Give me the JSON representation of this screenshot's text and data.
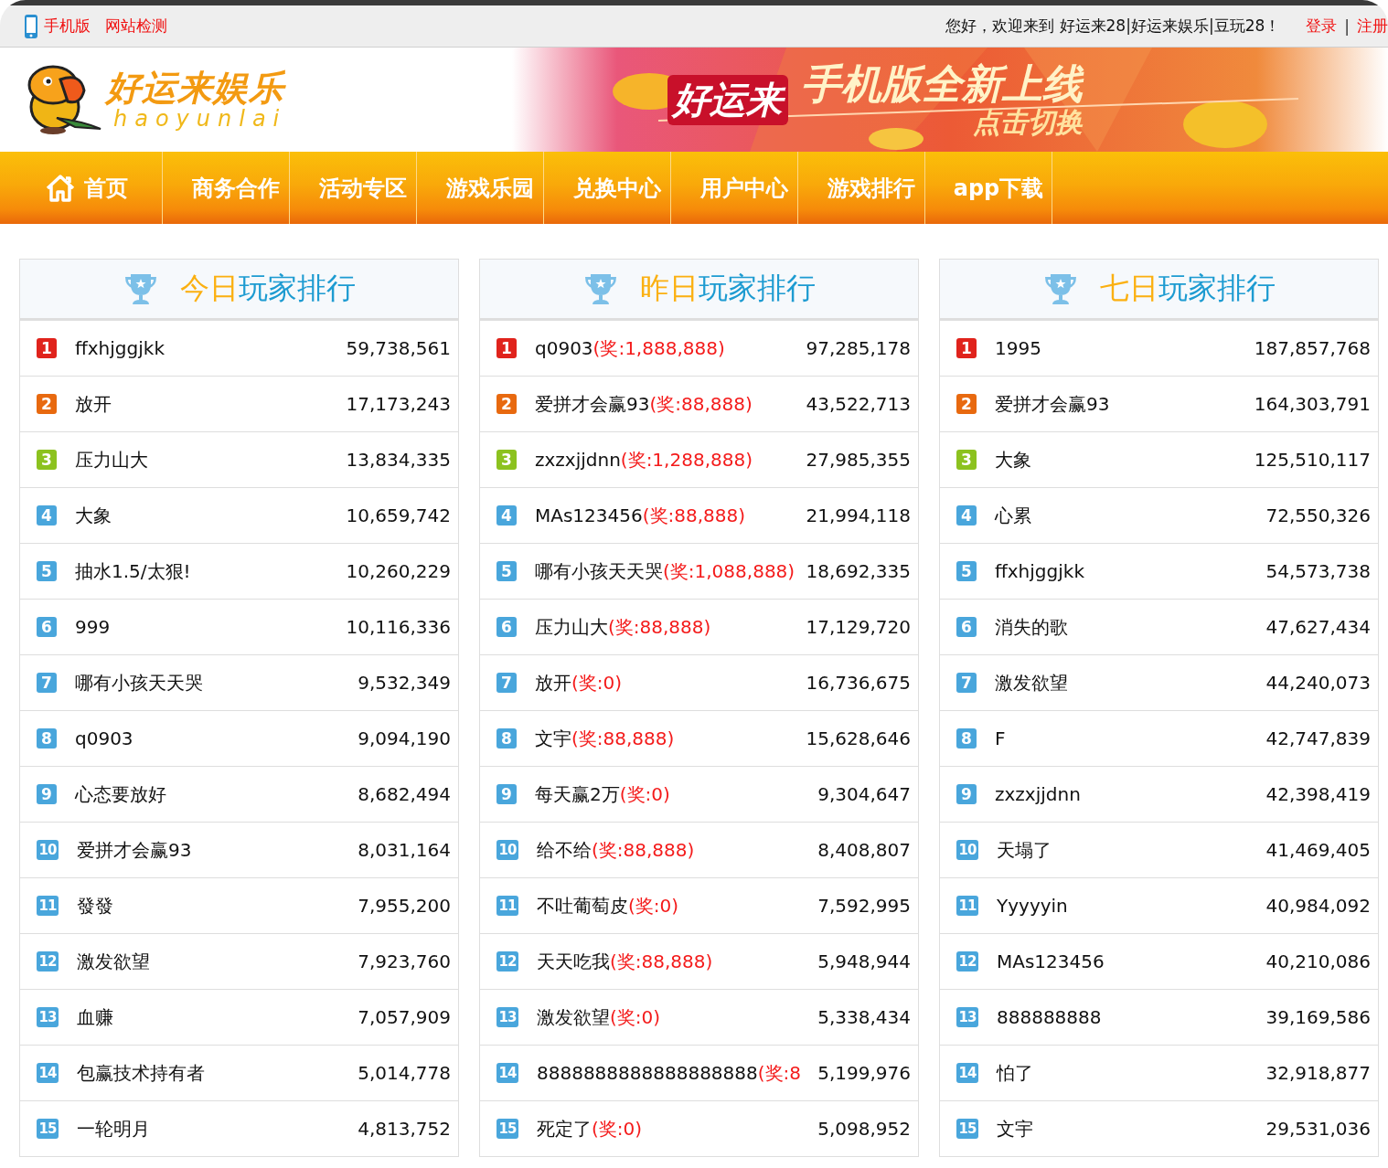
{
  "top_bar": {
    "left_links": [
      "手机版",
      "网站检测"
    ],
    "welcome": "您好，欢迎来到 好运来28|好运来娱乐|豆玩28！",
    "right_links": [
      "登录",
      "注册"
    ],
    "separator": "|"
  },
  "header": {
    "logo_title": "好运来娱乐",
    "logo_subtitle": "haoyunlai",
    "banner": {
      "brand": "好运来",
      "headline": "手机版全新上线",
      "subline": "点击切换"
    }
  },
  "nav": [
    {
      "label": "首页",
      "kind": "home"
    },
    {
      "label": "商务合作",
      "kind": "plain"
    },
    {
      "label": "活动专区",
      "kind": "plain"
    },
    {
      "label": "游戏乐园",
      "kind": "plain"
    },
    {
      "label": "兑换中心",
      "kind": "plain"
    },
    {
      "label": "用户中心",
      "kind": "plain"
    },
    {
      "label": "游戏排行",
      "kind": "plain"
    },
    {
      "label": "app下载",
      "kind": "plain"
    }
  ],
  "rankings": [
    {
      "title_highlight": "今日",
      "title_rest": "玩家排行",
      "rows": [
        {
          "rank": "1",
          "color": "#e0231c",
          "name": "ffxhjggjkk",
          "score": "59,738,561"
        },
        {
          "rank": "2",
          "color": "#e8690f",
          "name": "放开",
          "score": "17,173,243"
        },
        {
          "rank": "3",
          "color": "#8cc21f",
          "name": "压力山大",
          "score": "13,834,335"
        },
        {
          "rank": "4",
          "color": "#49a6dc",
          "name": "大象",
          "score": "10,659,742"
        },
        {
          "rank": "5",
          "color": "#49a6dc",
          "name": "抽水1.5/太狠!",
          "score": "10,260,229"
        },
        {
          "rank": "6",
          "color": "#49a6dc",
          "name": "999",
          "score": "10,116,336"
        },
        {
          "rank": "7",
          "color": "#49a6dc",
          "name": "哪有小孩天天哭",
          "score": "9,532,349"
        },
        {
          "rank": "8",
          "color": "#49a6dc",
          "name": "q0903",
          "score": "9,094,190"
        },
        {
          "rank": "9",
          "color": "#49a6dc",
          "name": "心态要放好",
          "score": "8,682,494"
        },
        {
          "rank": "10",
          "color": "#49a6dc",
          "name": "爱拼才会赢93",
          "score": "8,031,164"
        },
        {
          "rank": "11",
          "color": "#49a6dc",
          "name": "發發",
          "score": "7,955,200"
        },
        {
          "rank": "12",
          "color": "#49a6dc",
          "name": "激发欲望",
          "score": "7,923,760"
        },
        {
          "rank": "13",
          "color": "#49a6dc",
          "name": "血赚",
          "score": "7,057,909"
        },
        {
          "rank": "14",
          "color": "#49a6dc",
          "name": "包赢技术持有者",
          "score": "5,014,778"
        },
        {
          "rank": "15",
          "color": "#49a6dc",
          "name": "一轮明月",
          "score": "4,813,752"
        }
      ]
    },
    {
      "title_highlight": "昨日",
      "title_rest": "玩家排行",
      "rows": [
        {
          "rank": "1",
          "color": "#e0231c",
          "name": "q0903",
          "prize": "(奖:1,888,888)",
          "score": "97,285,178"
        },
        {
          "rank": "2",
          "color": "#e8690f",
          "name": "爱拼才会赢93",
          "prize": "(奖:88,888)",
          "score": "43,522,713"
        },
        {
          "rank": "3",
          "color": "#8cc21f",
          "name": "zxzxjjdnn",
          "prize": "(奖:1,288,888)",
          "score": "27,985,355"
        },
        {
          "rank": "4",
          "color": "#49a6dc",
          "name": "MAs123456",
          "prize": "(奖:88,888)",
          "score": "21,994,118"
        },
        {
          "rank": "5",
          "color": "#49a6dc",
          "name": "哪有小孩天天哭",
          "prize": "(奖:1,088,888)",
          "score": "18,692,335"
        },
        {
          "rank": "6",
          "color": "#49a6dc",
          "name": "压力山大",
          "prize": "(奖:88,888)",
          "score": "17,129,720"
        },
        {
          "rank": "7",
          "color": "#49a6dc",
          "name": "放开",
          "prize": "(奖:0)",
          "score": "16,736,675"
        },
        {
          "rank": "8",
          "color": "#49a6dc",
          "name": "文宇",
          "prize": "(奖:88,888)",
          "score": "15,628,646"
        },
        {
          "rank": "9",
          "color": "#49a6dc",
          "name": "每天赢2万",
          "prize": "(奖:0)",
          "score": "9,304,647"
        },
        {
          "rank": "10",
          "color": "#49a6dc",
          "name": "给不给",
          "prize": "(奖:88,888)",
          "score": "8,408,807"
        },
        {
          "rank": "11",
          "color": "#49a6dc",
          "name": "不吐葡萄皮",
          "prize": "(奖:0)",
          "score": "7,592,995"
        },
        {
          "rank": "12",
          "color": "#49a6dc",
          "name": "天天吃我",
          "prize": "(奖:88,888)",
          "score": "5,948,944"
        },
        {
          "rank": "13",
          "color": "#49a6dc",
          "name": "激发欲望",
          "prize": "(奖:0)",
          "score": "5,338,434"
        },
        {
          "rank": "14",
          "color": "#49a6dc",
          "name": "8888888888888888888",
          "prize": "(奖:8",
          "score": "5,199,976"
        },
        {
          "rank": "15",
          "color": "#49a6dc",
          "name": "死定了",
          "prize": "(奖:0)",
          "score": "5,098,952"
        }
      ]
    },
    {
      "title_highlight": "七日",
      "title_rest": "玩家排行",
      "rows": [
        {
          "rank": "1",
          "color": "#e0231c",
          "name": "1995",
          "score": "187,857,768"
        },
        {
          "rank": "2",
          "color": "#e8690f",
          "name": "爱拼才会赢93",
          "score": "164,303,791"
        },
        {
          "rank": "3",
          "color": "#8cc21f",
          "name": "大象",
          "score": "125,510,117"
        },
        {
          "rank": "4",
          "color": "#49a6dc",
          "name": "心累",
          "score": "72,550,326"
        },
        {
          "rank": "5",
          "color": "#49a6dc",
          "name": "ffxhjggjkk",
          "score": "54,573,738"
        },
        {
          "rank": "6",
          "color": "#49a6dc",
          "name": "消失的歌",
          "score": "47,627,434"
        },
        {
          "rank": "7",
          "color": "#49a6dc",
          "name": "激发欲望",
          "score": "44,240,073"
        },
        {
          "rank": "8",
          "color": "#49a6dc",
          "name": "F",
          "score": "42,747,839"
        },
        {
          "rank": "9",
          "color": "#49a6dc",
          "name": "zxzxjjdnn",
          "score": "42,398,419"
        },
        {
          "rank": "10",
          "color": "#49a6dc",
          "name": "天塌了",
          "score": "41,469,405"
        },
        {
          "rank": "11",
          "color": "#49a6dc",
          "name": "Yyyyyin",
          "score": "40,984,092"
        },
        {
          "rank": "12",
          "color": "#49a6dc",
          "name": "MAs123456",
          "score": "40,210,086"
        },
        {
          "rank": "13",
          "color": "#49a6dc",
          "name": "888888888",
          "score": "39,169,586"
        },
        {
          "rank": "14",
          "color": "#49a6dc",
          "name": "怕了",
          "score": "32,918,877"
        },
        {
          "rank": "15",
          "color": "#49a6dc",
          "name": "文宇",
          "score": "29,531,036"
        }
      ]
    }
  ]
}
